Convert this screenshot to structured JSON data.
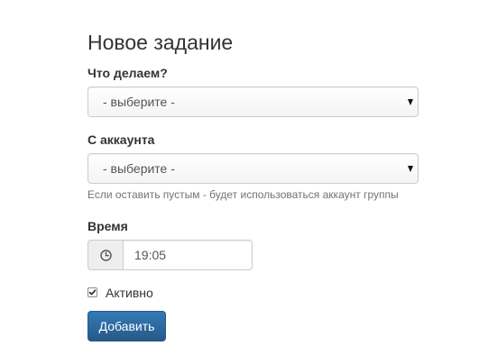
{
  "form": {
    "title": "Новое задание",
    "action": {
      "label": "Что делаем?",
      "selected": "- выберите -"
    },
    "account": {
      "label": "С аккаунта",
      "selected": "- выберите -",
      "help": "Если оставить пустым - будет использоваться аккаунт группы"
    },
    "time": {
      "label": "Время",
      "value": "19:05",
      "icon": "clock-icon"
    },
    "active": {
      "label": "Активно",
      "checked": true
    },
    "submit_label": "Добавить"
  },
  "colors": {
    "primary_button": "#337ab7",
    "text": "#333333",
    "help_text": "#737373",
    "border": "#cccccc"
  }
}
